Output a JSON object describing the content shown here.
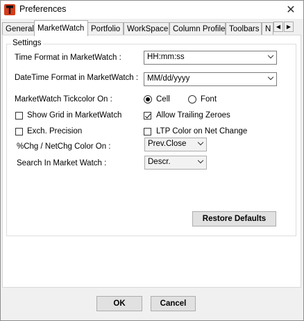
{
  "window": {
    "title": "Preferences",
    "close_glyph": "✕"
  },
  "tabs": {
    "items": [
      {
        "label": "General"
      },
      {
        "label": "MarketWatch"
      },
      {
        "label": "Portfolio"
      },
      {
        "label": "WorkSpace"
      },
      {
        "label": "Column Profile"
      },
      {
        "label": "Toolbars"
      },
      {
        "label": "N"
      }
    ],
    "active": "MarketWatch",
    "scroll_left": "◀",
    "scroll_right": "▶"
  },
  "settings": {
    "group_label": "Settings",
    "time_format": {
      "label": "Time Format in MarketWatch :",
      "value": "HH:mm:ss"
    },
    "datetime_format": {
      "label": "DateTime Format in MarketWatch :",
      "value": "MM/dd/yyyy"
    },
    "tickcolor": {
      "label": "MarketWatch Tickcolor On :",
      "options": [
        {
          "label": "Cell",
          "selected": true
        },
        {
          "label": "Font",
          "selected": false
        }
      ]
    },
    "show_grid": {
      "label": "Show Grid in MarketWatch",
      "checked": false
    },
    "allow_trailing_zeroes": {
      "label": "Allow Trailing Zeroes",
      "checked": true
    },
    "exch_precision": {
      "label": "Exch. Precision",
      "checked": false
    },
    "ltp_color": {
      "label": "LTP Color on Net Change",
      "checked": false
    },
    "chg_color": {
      "label": "%Chg / NetChg Color On :",
      "value": "Prev.Close"
    },
    "search": {
      "label": "Search In Market Watch :",
      "value": "Descr."
    },
    "restore_defaults": "Restore Defaults"
  },
  "footer": {
    "ok": "OK",
    "cancel": "Cancel"
  }
}
